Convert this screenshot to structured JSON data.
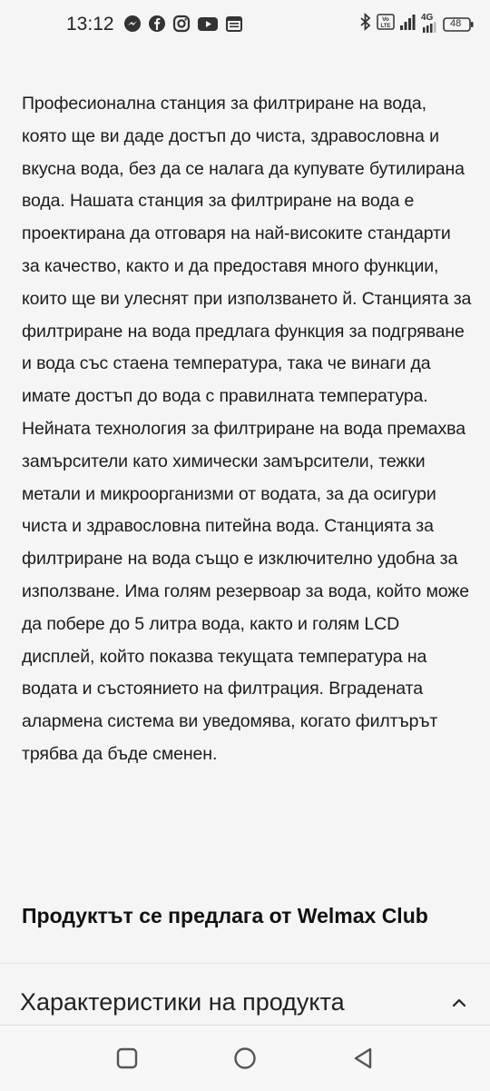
{
  "status_bar": {
    "time": "13:12",
    "app_icons": [
      "messenger-icon",
      "facebook-icon",
      "instagram-icon",
      "youtube-icon",
      "calendar-icon"
    ],
    "network_label": "4G",
    "battery_level": "48"
  },
  "article": {
    "description": "Професионална станция за филтриране на вода, която ще ви даде достъп до чиста, здравословна и вкусна вода, без да се налага да купувате бутилирана вода. Нашата станция за филтриране на вода е проектирана да отговаря на най-високите стандарти за качество, както и да предоставя много функции, които ще ви улеснят при използването й. Станцията за филтриране на вода предлага функция за подгряване и вода със стаена температура, така че винаги да имате достъп до вода с правилната температура. Нейната технология за филтриране на вода премахва замърсители като химически замърсители, тежки метали и микроорганизми от водата, за да осигури чиста и здравословна питейна вода. Станцията за филтриране на вода също е изключително удобна за използване. Има голям резервоар за вода, който може да побере до 5 литра вода, както и голям LCD дисплей, който показва текущата температура на водата и състоянието на филтрация. Вградената алармена система ви уведомява, когато филтърът трябва да бъде сменен.",
    "seller_heading": "Продуктът се предлага от Welmax Club"
  },
  "accordion": {
    "title": "Характеристики на продукта",
    "state": "expanded"
  },
  "nav_bar": {
    "buttons": [
      "recents-button",
      "home-button",
      "back-button"
    ]
  }
}
